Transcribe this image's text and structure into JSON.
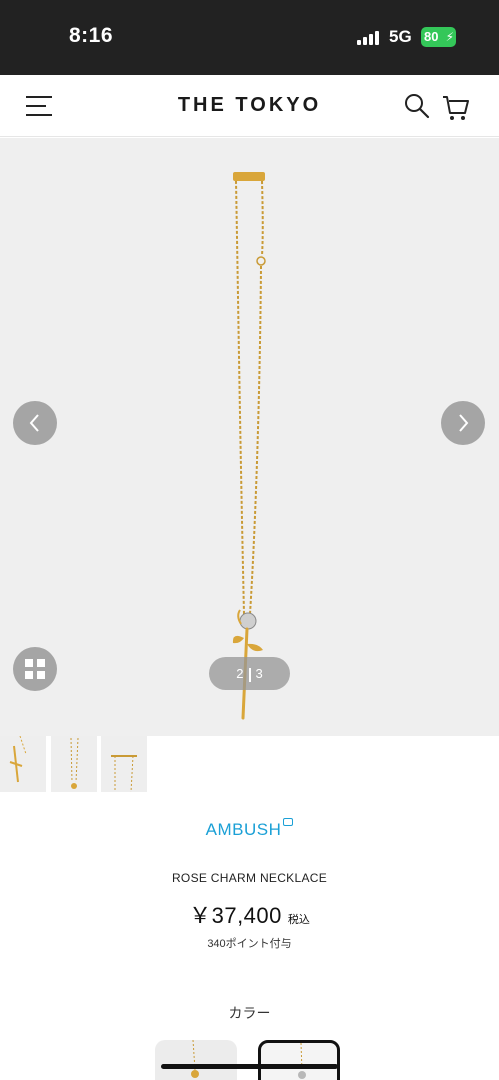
{
  "status_bar": {
    "time": "8:16",
    "network": "5G",
    "battery": "80"
  },
  "header": {
    "title": "THE TOKYO",
    "icons": [
      "menu-icon",
      "search-icon",
      "cart-icon"
    ]
  },
  "gallery": {
    "pager": {
      "current": "2",
      "next": "3"
    }
  },
  "product": {
    "brand": "AMBUSH",
    "name": "ROSE CHARM NECKLACE",
    "price": "￥37,400",
    "tax_label": "税込",
    "points": "340ポイント付与"
  },
  "color_section": {
    "label": "カラー"
  },
  "colors": {
    "accent": "#1ba0d6",
    "gold": "#d9a63a",
    "battery": "#34c759"
  }
}
